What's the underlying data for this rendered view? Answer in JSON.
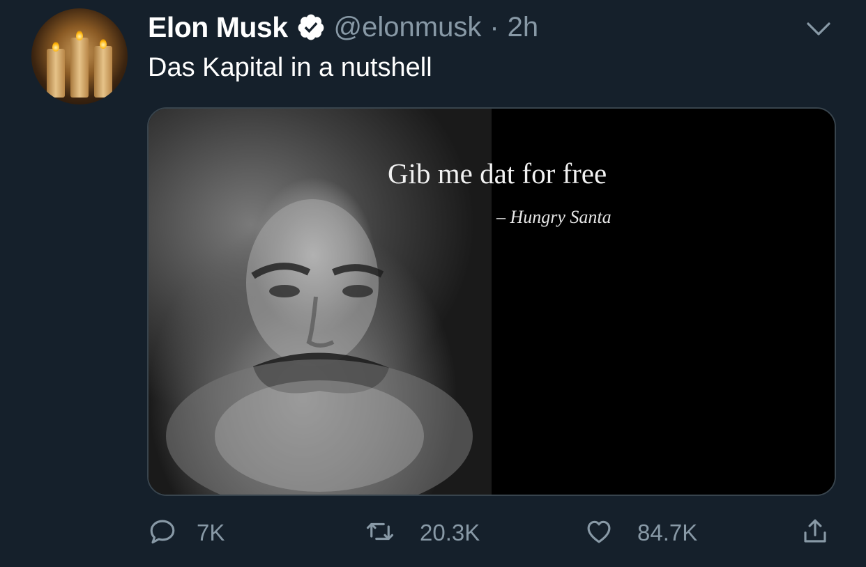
{
  "author": {
    "name": "Elon Musk",
    "handle": "@elonmusk",
    "separator": "·",
    "time": "2h",
    "verified": true
  },
  "tweet": {
    "text": "Das Kapital in a nutshell"
  },
  "media": {
    "quote_text": "Gib me dat for free",
    "quote_attribution": "– Hungry Santa"
  },
  "actions": {
    "reply_count": "7K",
    "retweet_count": "20.3K",
    "like_count": "84.7K"
  },
  "icons": {
    "verified": "verified-badge-icon",
    "more": "chevron-down-icon",
    "reply": "reply-icon",
    "retweet": "retweet-icon",
    "like": "heart-icon",
    "share": "share-icon"
  },
  "colors": {
    "background": "#15202b",
    "secondary_text": "#8899a6",
    "border": "#38444d"
  }
}
